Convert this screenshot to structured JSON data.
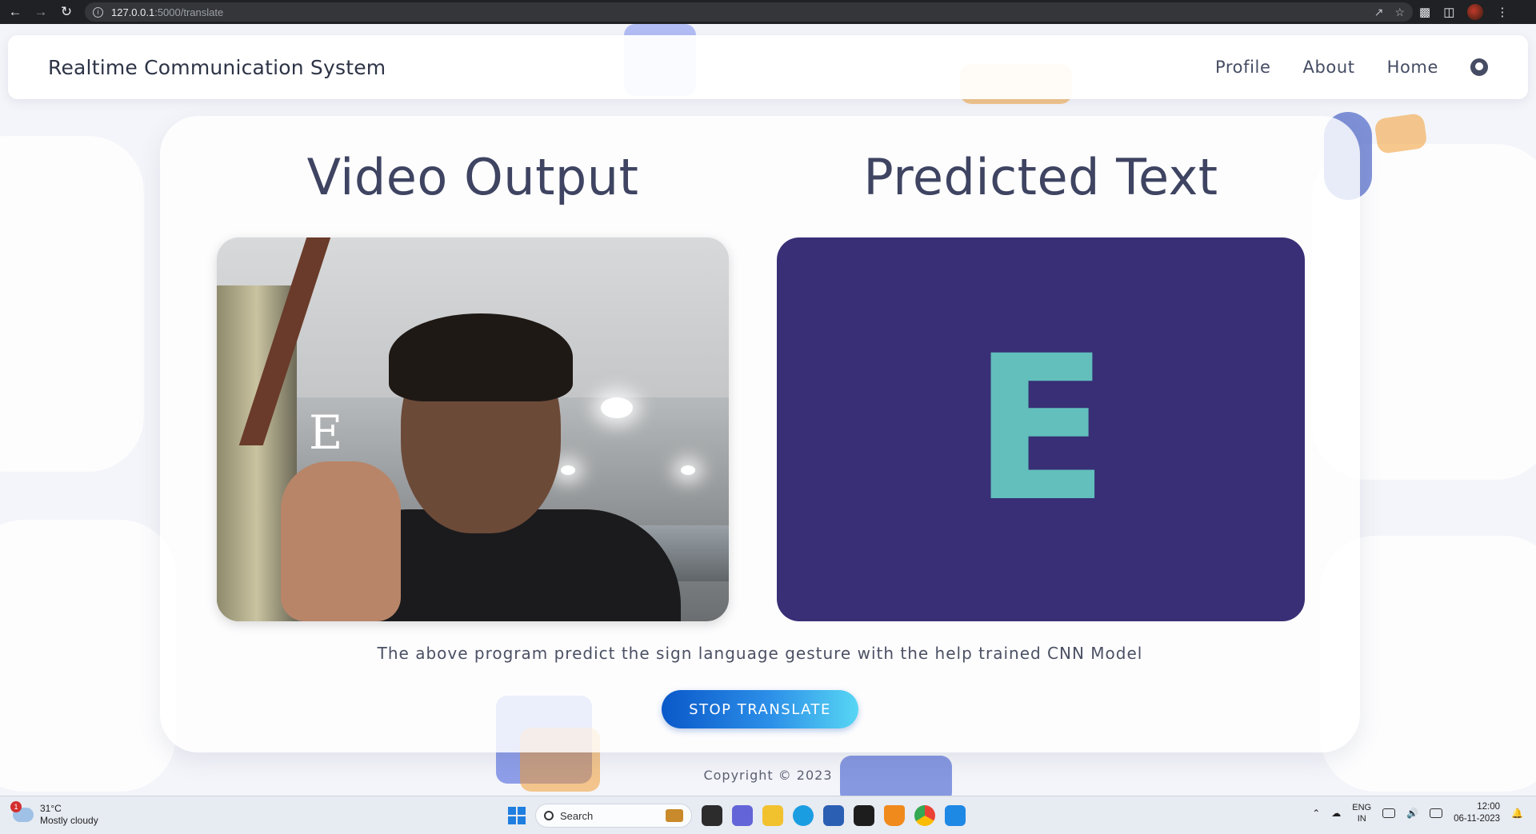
{
  "browser": {
    "url_host": "127.0.0.1",
    "url_path": ":5000/translate"
  },
  "navbar": {
    "brand": "Realtime Communication System",
    "links": [
      "Profile",
      "About",
      "Home"
    ]
  },
  "main": {
    "video_title": "Video Output",
    "prediction_title": "Predicted Text",
    "video_overlay_letter": "E",
    "predicted_letter": "E",
    "caption": "The above program predict the sign language gesture with the help trained CNN Model",
    "stop_button": "STOP TRANSLATE"
  },
  "footer": {
    "copyright": "Copyright © 2023"
  },
  "taskbar": {
    "weather_badge": "1",
    "temperature": "31°C",
    "condition": "Mostly cloudy",
    "search_placeholder": "Search",
    "language_line1": "ENG",
    "language_line2": "IN",
    "time": "12:00",
    "date": "06-11-2023"
  },
  "colors": {
    "prediction_bg": "#382f76",
    "prediction_letter": "#62bfbc",
    "button_gradient_start": "#0a58c9",
    "button_gradient_end": "#57d6f4",
    "heading": "#3e4461"
  }
}
